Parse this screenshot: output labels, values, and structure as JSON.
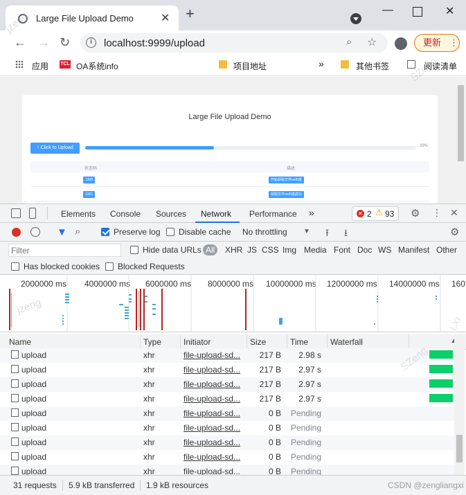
{
  "browser": {
    "tab_title": "Large File Upload Demo",
    "url": "localhost:9999/upload",
    "update_label": "更新",
    "bookmarks": [
      "应用",
      "OA系统info",
      "项目地址",
      "其他书签",
      "阅读清单"
    ],
    "overflow_label": "»"
  },
  "page": {
    "title": "Large File Upload Demo",
    "upload_button": "Click to Upload",
    "progress_percent": 39,
    "progress_label": "39%",
    "table_headers": [
      "状态码",
      "描述"
    ],
    "table_rows": [
      {
        "code": "1300",
        "desc": "开始获取文件md5值"
      },
      {
        "code": "1301",
        "desc": "获取文件md5值成功"
      }
    ]
  },
  "devtools": {
    "tabs": [
      "Elements",
      "Console",
      "Sources",
      "Network",
      "Performance"
    ],
    "active_tab": "Network",
    "more_tabs": "»",
    "error_count": "2",
    "warning_count": "93",
    "controls": {
      "preserve_log": "Preserve log",
      "disable_cache": "Disable cache",
      "throttling": "No throttling"
    },
    "filter": {
      "placeholder": "Filter",
      "hide_data_urls": "Hide data URLs",
      "types": [
        "All",
        "XHR",
        "JS",
        "CSS",
        "Img",
        "Media",
        "Font",
        "Doc",
        "WS",
        "Manifest",
        "Other"
      ],
      "has_blocked_cookies": "Has blocked cookies",
      "blocked_requests": "Blocked Requests"
    },
    "timeline_ticks": [
      "2000000 ms",
      "4000000 ms",
      "6000000 ms",
      "8000000 ms",
      "10000000 ms",
      "12000000 ms",
      "14000000 ms",
      "160"
    ],
    "columns": [
      "Name",
      "Type",
      "Initiator",
      "Size",
      "Time",
      "Waterfall"
    ],
    "rows": [
      {
        "name": "upload",
        "type": "xhr",
        "initiator": "file-upload-sd...",
        "size": "217 B",
        "time": "2.98 s",
        "done": true
      },
      {
        "name": "upload",
        "type": "xhr",
        "initiator": "file-upload-sd...",
        "size": "217 B",
        "time": "2.97 s",
        "done": true
      },
      {
        "name": "upload",
        "type": "xhr",
        "initiator": "file-upload-sd...",
        "size": "217 B",
        "time": "2.97 s",
        "done": true
      },
      {
        "name": "upload",
        "type": "xhr",
        "initiator": "file-upload-sd...",
        "size": "217 B",
        "time": "2.97 s",
        "done": true
      },
      {
        "name": "upload",
        "type": "xhr",
        "initiator": "file-upload-sd...",
        "size": "0 B",
        "time": "Pending",
        "done": false
      },
      {
        "name": "upload",
        "type": "xhr",
        "initiator": "file-upload-sd...",
        "size": "0 B",
        "time": "Pending",
        "done": false
      },
      {
        "name": "upload",
        "type": "xhr",
        "initiator": "file-upload-sd...",
        "size": "0 B",
        "time": "Pending",
        "done": false
      },
      {
        "name": "upload",
        "type": "xhr",
        "initiator": "file-upload-sd...",
        "size": "0 B",
        "time": "Pending",
        "done": false
      },
      {
        "name": "upload",
        "type": "xhr",
        "initiator": "file-upload-sd...",
        "size": "0 B",
        "time": "Pending",
        "done": false
      }
    ],
    "status": {
      "requests": "31 requests",
      "transferred": "5.9 kB transferred",
      "resources": "1.9 kB resources"
    }
  },
  "watermarks": [
    "CSDN @zengliangxi",
    "jzeng",
    "SZeng",
    "LXI"
  ]
}
